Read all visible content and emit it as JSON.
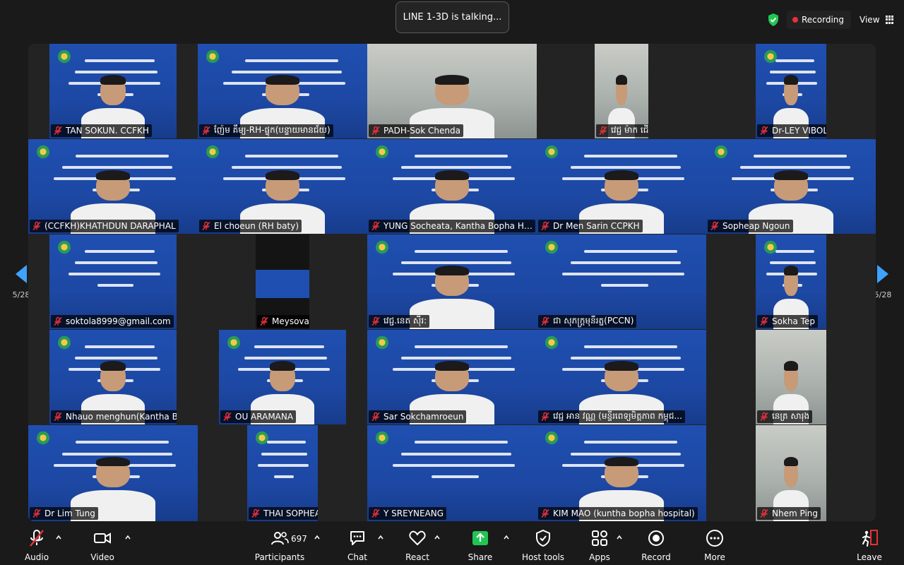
{
  "header": {
    "talking": "LINE 1-3D is talking...",
    "recording": "Recording",
    "view": "View"
  },
  "nav": {
    "left_page": "5/28",
    "right_page": "5/28"
  },
  "participants": [
    {
      "name": "TAN SOKUN.   CCFKH"
    },
    {
      "name": "ញ៉ែម គឹម្យ-RH-ផ្ទុក(បន្ទាយមានជ័យ)"
    },
    {
      "name": "PADH-Sok Chenda"
    },
    {
      "name": "វេជ្ជ ម៉ាក ជើត (CCFKH)"
    },
    {
      "name": "Dr-LEY VIBOL"
    },
    {
      "name": "(CCFKH)KHATHDUN DARAPHAL"
    },
    {
      "name": "El choeun (RH baty)"
    },
    {
      "name": "YUNG Socheata, Kantha Bopha Hosp..."
    },
    {
      "name": "Dr Men Sarin CCPKH"
    },
    {
      "name": "Sopheap Ngoun"
    },
    {
      "name": "soktola8999@gmail.com"
    },
    {
      "name": "Meysovanneth"
    },
    {
      "name": "វេជ្ជ.នេត ស៊ីរ:"
    },
    {
      "name": "ជា សុភក្ត្រមុនីរត្ន(PCCN)"
    },
    {
      "name": "Sokha Tep"
    },
    {
      "name": "Nhauo menghun(Kantha Bopha Chil..."
    },
    {
      "name": "OU ARAMANA"
    },
    {
      "name": "Sar Sokchamroeun"
    },
    {
      "name": "វេជ្ជ អាន វណ្ណ (មន្ទីរពេទ្យមិត្តភាព កម្ពុជ..."
    },
    {
      "name": "នេត្រ សារុង"
    },
    {
      "name": "Dr Lim Tung"
    },
    {
      "name": "THAI SOPHEAK"
    },
    {
      "name": "Y SREYNEANG"
    },
    {
      "name": "KIM MAO (kuntha bopha hospital)"
    },
    {
      "name": "Nhem Ping"
    }
  ],
  "toolbar": {
    "audio": "Audio",
    "video": "Video",
    "participants": "Participants",
    "participants_count": "697",
    "chat": "Chat",
    "react": "React",
    "share": "Share",
    "host_tools": "Host tools",
    "apps": "Apps",
    "record": "Record",
    "more": "More",
    "leave": "Leave"
  },
  "colors": {
    "accent_blue": "#3ea2ff",
    "share_green": "#23c552",
    "recording_red": "#e8303b",
    "muted_red": "#e8303b",
    "slide_blue": "#1f4fb0"
  }
}
